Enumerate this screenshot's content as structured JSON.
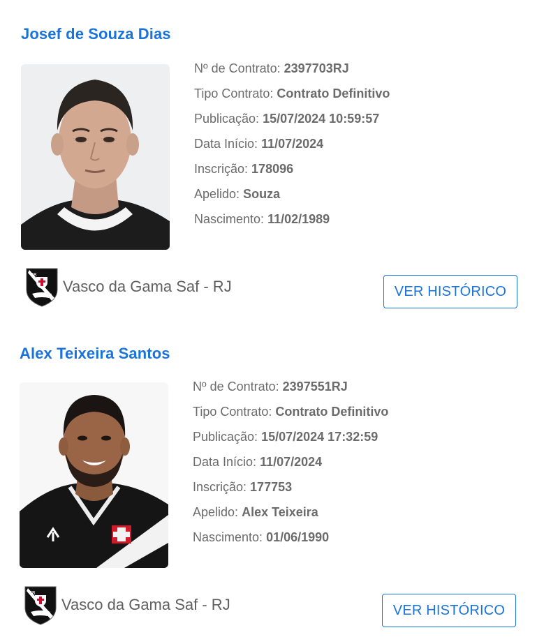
{
  "labels": {
    "contract": "Nº de Contrato:",
    "type": "Tipo Contrato:",
    "publication": "Publicação:",
    "start": "Data Início:",
    "registration": "Inscrição:",
    "nickname": "Apelido:",
    "birth": "Nascimento:"
  },
  "players": [
    {
      "name": "Josef de Souza Dias",
      "contract": "2397703RJ",
      "type": "Contrato Definitivo",
      "publication": "15/07/2024 10:59:57",
      "start": "11/07/2024",
      "registration": "178096",
      "nickname": "Souza",
      "birth": "11/02/1989",
      "club": "Vasco da Gama Saf - RJ",
      "history_button": "VER HISTÓRICO"
    },
    {
      "name": "Alex Teixeira Santos",
      "contract": "2397551RJ",
      "type": "Contrato Definitivo",
      "publication": "15/07/2024 17:32:59",
      "start": "11/07/2024",
      "registration": "177753",
      "nickname": "Alex Teixeira",
      "birth": "01/06/1990",
      "club": "Vasco da Gama Saf - RJ",
      "history_button": "VER HISTÓRICO"
    }
  ],
  "colors": {
    "accent": "#1a73d9",
    "text": "#6b6b6b"
  }
}
